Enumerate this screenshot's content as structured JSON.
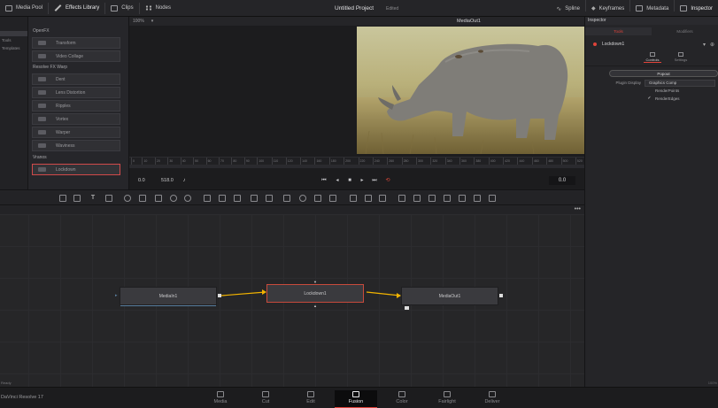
{
  "topbar": {
    "media_pool": "Media Pool",
    "effects_library": "Effects Library",
    "clips": "Clips",
    "nodes": "Nodes",
    "project_title": "Untitled Project",
    "project_status": "Edited",
    "spline": "Spline",
    "keyframes": "Keyframes",
    "metadata": "Metadata",
    "inspector": "Inspector"
  },
  "effects_library": {
    "tree": [
      {
        "label": "",
        "selected": true
      },
      {
        "label": "Tools",
        "selected": false
      },
      {
        "label": "Templates",
        "selected": false
      }
    ],
    "groups": [
      {
        "title": "OpenFX",
        "items": [
          "Transform",
          "Video Collage"
        ]
      },
      {
        "title": "Resolve FX Warp",
        "items": [
          "Dent",
          "Lens Distortion",
          "Ripples",
          "Vortex",
          "Warper",
          "Waviness"
        ]
      },
      {
        "title": "Vranos",
        "items": [
          "Lockdown"
        ]
      }
    ],
    "selected_item": "Lockdown"
  },
  "viewer": {
    "zoom": "100%",
    "title": "MediaOut1",
    "ruler_ticks": [
      "0",
      "10",
      "20",
      "30",
      "40",
      "50",
      "60",
      "70",
      "80",
      "90",
      "100",
      "110",
      "120",
      "140",
      "160",
      "180",
      "200",
      "220",
      "240",
      "260",
      "280",
      "300",
      "320",
      "340",
      "360",
      "380",
      "400",
      "420",
      "440",
      "460",
      "480",
      "500",
      "520"
    ],
    "timecode_start": "0.0",
    "timecode_end": "518.0",
    "current_frame": "0.0"
  },
  "inspector": {
    "header": "Inspector",
    "tabs": [
      "Tools",
      "Modifiers"
    ],
    "node_name": "Lockdown1",
    "sub_tabs": [
      "Controls",
      "Settings"
    ],
    "popout_label": "Popout",
    "plugin_display_label": "Plugin Display",
    "plugin_display_value": "Graphics Comp",
    "checkboxes": [
      {
        "label": "RenderPoints",
        "checked": false
      },
      {
        "label": "RenderEdges",
        "checked": true
      }
    ]
  },
  "nodes": [
    {
      "name": "MediaIn1",
      "selected": false
    },
    {
      "name": "Lockdown1",
      "selected": true
    },
    {
      "name": "MediaOut1",
      "selected": false
    }
  ],
  "node_editor": {
    "menu": "•••",
    "status": "Ready"
  },
  "pages": [
    "Media",
    "Cut",
    "Edit",
    "Fusion",
    "Color",
    "Fairlight",
    "Deliver"
  ],
  "active_page": "Fusion",
  "app_name": "DaVinci Resolve 17",
  "version_tag": "100%",
  "colors": {
    "accent": "#e0433a",
    "selected_border": "#c84a3c",
    "link_line": "#f2b300",
    "background": "#1b1b1d"
  }
}
